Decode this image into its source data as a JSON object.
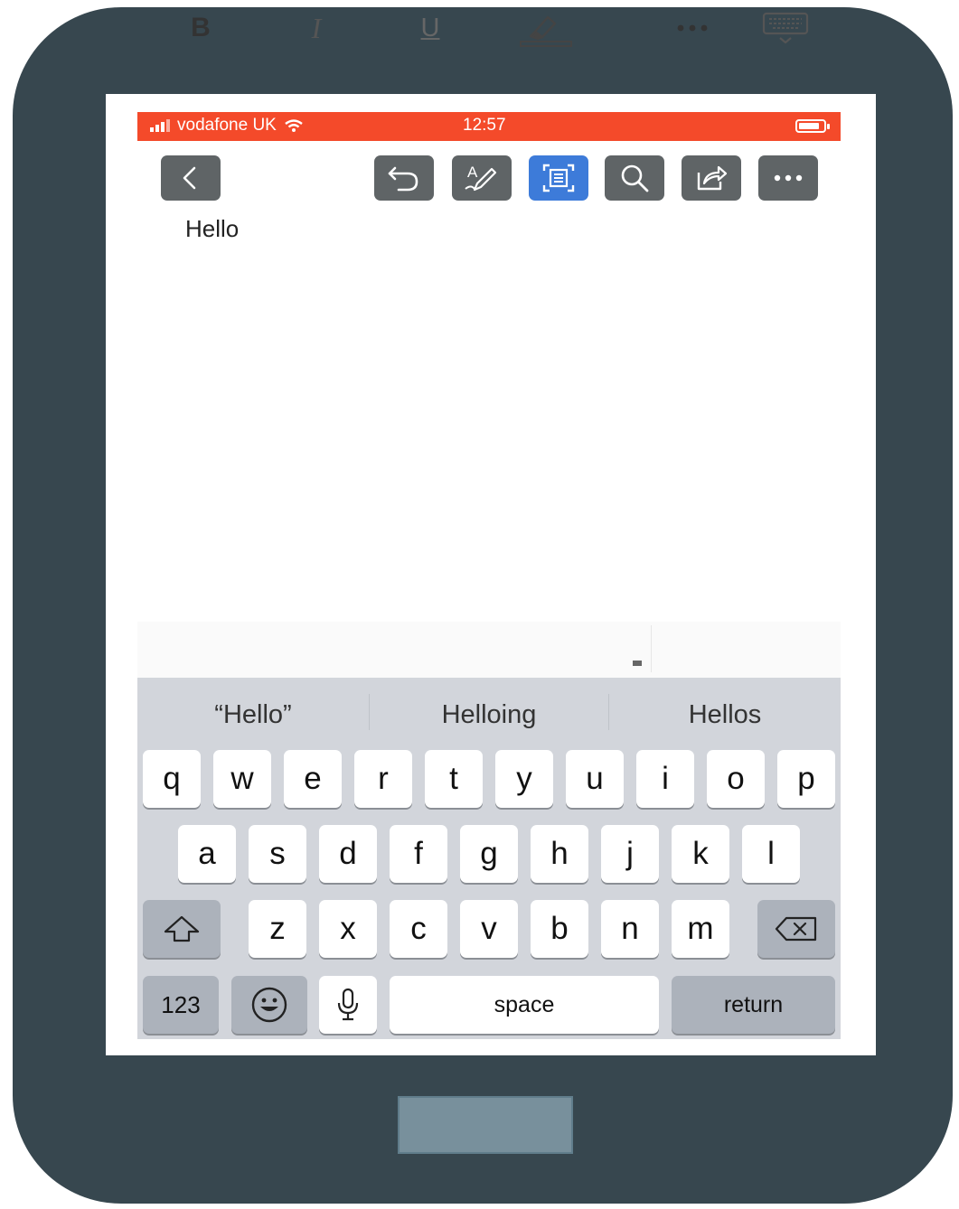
{
  "status_bar": {
    "carrier": "vodafone UK",
    "time": "12:57",
    "color": "#f44a2a"
  },
  "toolbar": {
    "items": [
      {
        "name": "back-button",
        "icon": "chevron-left-icon"
      },
      {
        "name": "undo-button",
        "icon": "undo-icon"
      },
      {
        "name": "edit-mode-button",
        "icon": "text-edit-pen-icon"
      },
      {
        "name": "reading-view-button",
        "icon": "document-fit-icon",
        "active": true
      },
      {
        "name": "search-button",
        "icon": "search-icon"
      },
      {
        "name": "share-button",
        "icon": "share-icon"
      },
      {
        "name": "more-button",
        "icon": "ellipsis-icon"
      }
    ],
    "button_color": "#5f6466",
    "active_color": "#3d7bd9"
  },
  "document": {
    "text": "Hello"
  },
  "format_bar": {
    "bold": "B",
    "italic": "I",
    "underline": "U",
    "highlight_icon": "highlighter-icon",
    "more_icon": "ellipsis-icon",
    "dismiss_icon": "keyboard-dismiss-icon"
  },
  "keyboard": {
    "suggestions": [
      "“Hello”",
      "Helloing",
      "Hellos"
    ],
    "row1": [
      "q",
      "w",
      "e",
      "r",
      "t",
      "y",
      "u",
      "i",
      "o",
      "p"
    ],
    "row2": [
      "a",
      "s",
      "d",
      "f",
      "g",
      "h",
      "j",
      "k",
      "l"
    ],
    "row3": [
      "z",
      "x",
      "c",
      "v",
      "b",
      "n",
      "m"
    ],
    "numbers_label": "123",
    "space_label": "space",
    "return_label": "return",
    "shift_icon": "shift-icon",
    "delete_icon": "backspace-icon",
    "emoji_icon": "emoji-icon",
    "mic_icon": "microphone-icon"
  }
}
